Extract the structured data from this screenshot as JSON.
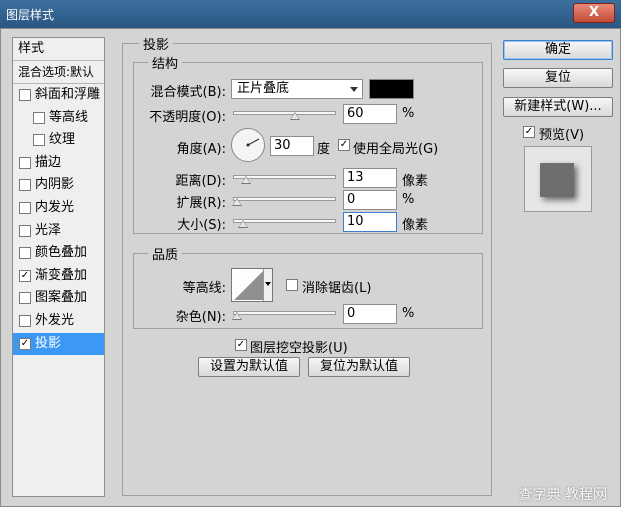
{
  "window": {
    "title": "图层样式",
    "close_label": "X"
  },
  "styles_panel": {
    "header": "样式",
    "blend_default": "混合选项:默认",
    "items": [
      {
        "label": "斜面和浮雕",
        "checked": false,
        "indent": false,
        "selected": false
      },
      {
        "label": "等高线",
        "checked": false,
        "indent": true,
        "selected": false
      },
      {
        "label": "纹理",
        "checked": false,
        "indent": true,
        "selected": false
      },
      {
        "label": "描边",
        "checked": false,
        "indent": false,
        "selected": false
      },
      {
        "label": "内阴影",
        "checked": false,
        "indent": false,
        "selected": false
      },
      {
        "label": "内发光",
        "checked": false,
        "indent": false,
        "selected": false
      },
      {
        "label": "光泽",
        "checked": false,
        "indent": false,
        "selected": false
      },
      {
        "label": "颜色叠加",
        "checked": false,
        "indent": false,
        "selected": false
      },
      {
        "label": "渐变叠加",
        "checked": true,
        "indent": false,
        "selected": false
      },
      {
        "label": "图案叠加",
        "checked": false,
        "indent": false,
        "selected": false
      },
      {
        "label": "外发光",
        "checked": false,
        "indent": false,
        "selected": false
      },
      {
        "label": "投影",
        "checked": true,
        "indent": false,
        "selected": true
      }
    ]
  },
  "drop_shadow": {
    "title": "投影",
    "structure": {
      "title": "结构",
      "blend_mode_label": "混合模式(B):",
      "blend_mode_value": "正片叠底",
      "shadow_color": "#000000",
      "opacity_label": "不透明度(O):",
      "opacity_value": "60",
      "opacity_unit": "%",
      "opacity_fraction": 0.6,
      "angle_label": "角度(A):",
      "angle_value": "30",
      "angle_unit": "度",
      "global_light_label": "使用全局光(G)",
      "global_light_checked": true,
      "distance_label": "距离(D):",
      "distance_value": "13",
      "distance_unit": "像素",
      "spread_label": "扩展(R):",
      "spread_value": "0",
      "spread_unit": "%",
      "size_label": "大小(S):",
      "size_value": "10",
      "size_unit": "像素"
    },
    "quality": {
      "title": "品质",
      "contour_label": "等高线:",
      "antialias_label": "消除锯齿(L)",
      "antialias_checked": false,
      "noise_label": "杂色(N):",
      "noise_value": "0",
      "noise_unit": "%"
    },
    "knockout_label": "图层挖空投影(U)",
    "knockout_checked": true,
    "make_default_label": "设置为默认值",
    "reset_default_label": "复位为默认值"
  },
  "actions": {
    "ok_label": "确定",
    "reset_label": "复位",
    "new_style_label": "新建样式(W)...",
    "preview_label": "预览(V)",
    "preview_checked": true
  },
  "watermark": "查字典 教程网",
  "colors": {
    "selected": "#3c98f5",
    "titlebar": "#2a5683"
  }
}
